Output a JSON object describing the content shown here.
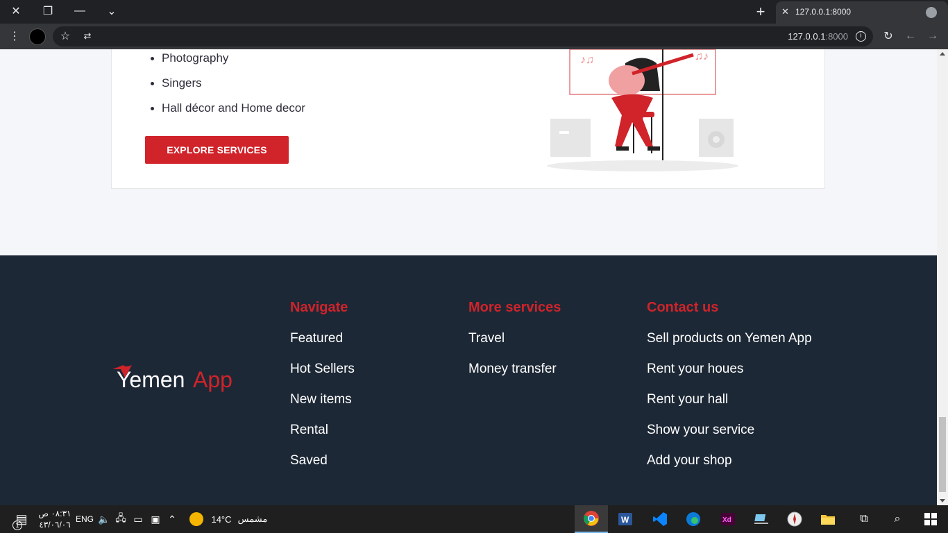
{
  "browser": {
    "tab_title": "127.0.0.1:8000",
    "url_host": "127.0.0.1",
    "url_port": ":8000"
  },
  "services": {
    "items": [
      "Photography",
      "Singers",
      "Hall décor and Home decor"
    ],
    "button_label": "EXPLORE SERVICES"
  },
  "footer": {
    "logo": {
      "part1": "Yemen",
      "part2": "App"
    },
    "navigate": {
      "title": "Navigate",
      "links": [
        "Featured",
        "Hot Sellers",
        "New items",
        "Rental",
        "Saved"
      ]
    },
    "more_services": {
      "title": "More services",
      "links": [
        "Travel",
        "Money transfer"
      ]
    },
    "contact": {
      "title": "Contact us",
      "links": [
        "Sell products on Yemen App",
        "Rent your houes",
        "Rent your hall",
        "Show your service",
        "Add your shop"
      ]
    }
  },
  "taskbar": {
    "time": "٠٨:٣١ ص",
    "date": "٤٣/٠٦/٠٦",
    "lang": "ENG",
    "weather_temp": "14°C",
    "weather_text": "مشمس",
    "notification_count": "1"
  },
  "colors": {
    "accent": "#d0232a",
    "footer_bg": "#1d2836",
    "page_bg": "#f5f6fa"
  }
}
